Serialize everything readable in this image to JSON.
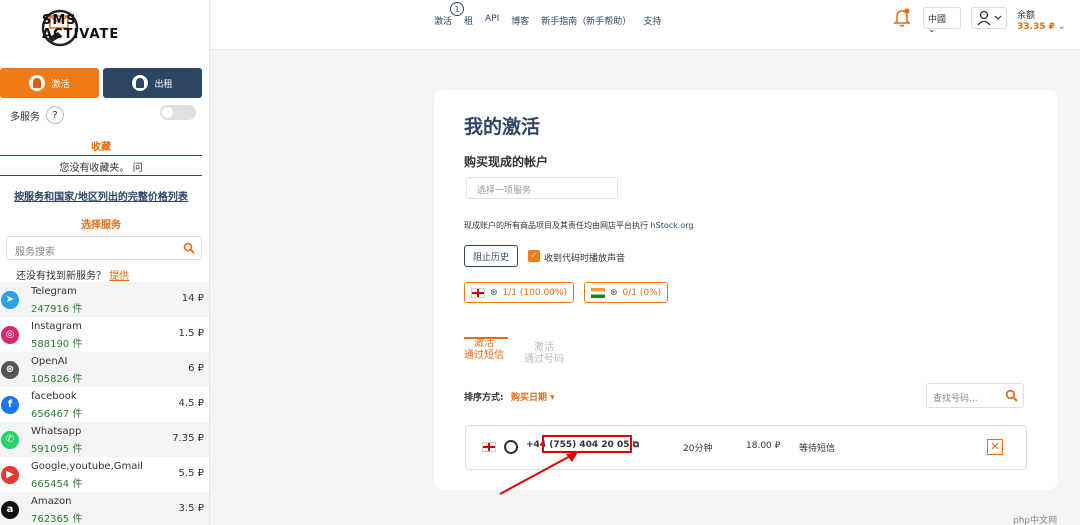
{
  "logo": {
    "line1": "SMS",
    "line2": "ACTIVATE"
  },
  "sidebar": {
    "tab_activate": "激活",
    "tab_rent": "出租",
    "multi_service": "多服务",
    "help": "?",
    "favorites_title": "收藏",
    "favorites_empty": "您没有收藏夹。 问",
    "price_list_link": "按服务和国家/地区列出的完整价格列表",
    "choose_service": "选择服务",
    "search_placeholder": "服务搜索",
    "not_found_text": "还没有找到新服务？",
    "not_found_link": "提供",
    "services": [
      {
        "name": "Telegram",
        "count": "247916 件",
        "price": "14 ₽",
        "icon": "telegram-icon",
        "color": "#2aa3e0"
      },
      {
        "name": "Instagram",
        "count": "588190 件",
        "price": "1.5 ₽",
        "icon": "instagram-icon",
        "color": "#d6286d"
      },
      {
        "name": "OpenAI",
        "count": "105826 件",
        "price": "6 ₽",
        "icon": "openai-icon",
        "color": "#555555"
      },
      {
        "name": "facebook",
        "count": "656467 件",
        "price": "4.5 ₽",
        "icon": "facebook-icon",
        "color": "#1877f2"
      },
      {
        "name": "Whatsapp",
        "count": "591095 件",
        "price": "7.35 ₽",
        "icon": "whatsapp-icon",
        "color": "#25d366"
      },
      {
        "name": "Google,youtube,Gmail",
        "count": "665454 件",
        "price": "5.5 ₽",
        "icon": "youtube-icon",
        "color": "#e53935"
      },
      {
        "name": "Amazon",
        "count": "762365 件",
        "price": "3.5 ₽",
        "icon": "amazon-icon",
        "color": "#111111"
      }
    ]
  },
  "header": {
    "nav": [
      "激活",
      "租",
      "API",
      "博客",
      "新手指南（新手帮助）",
      "支持"
    ],
    "nav_badge": "1",
    "language": "中國",
    "balance_label": "余额",
    "balance_value": "33.35 ₽"
  },
  "main": {
    "title": "我的激活",
    "buy_title": "购买现成的帐户",
    "buy_placeholder": "选择一项服务",
    "notice": "现成账户的所有商品项目及其责任均由网店平台执行",
    "notice_link": "hStock.org",
    "history_button": "阻止历史",
    "sound_checkbox_label": "收到代码时播放声音",
    "stats": [
      {
        "flag": "england",
        "value": "1/1 (100.00%)"
      },
      {
        "flag": "india",
        "value": "0/1 (0%)"
      }
    ],
    "tab_sms_line1": "激活",
    "tab_sms_line2": "通过短信",
    "tab_num_line1": "激活",
    "tab_num_line2": "通过号码",
    "sort_label": "排序方式:",
    "sort_value": "购买日期",
    "search_number_placeholder": "查找号码...",
    "activation": {
      "country_code": "+44",
      "number": "(755) 404 20 05",
      "time": "20分钟",
      "price": "18.00 ₽",
      "status": "等待短信"
    }
  },
  "watermark": "php中文网",
  "colors": {
    "accent": "#f07a15",
    "navy": "#2d4663",
    "highlight": "#dd0000"
  }
}
